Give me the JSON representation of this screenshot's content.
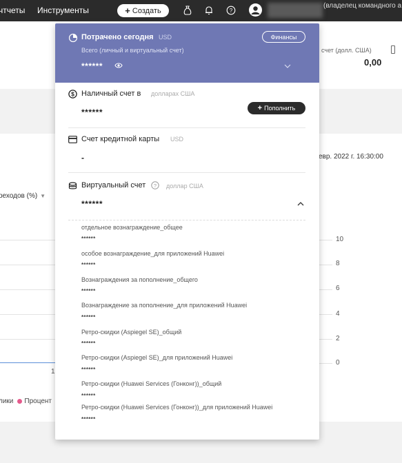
{
  "topbar": {
    "nav_reports": "чтчеты",
    "nav_tools": "Инструменты",
    "create_label": "Создать",
    "user_role": "(владелец командного а"
  },
  "background": {
    "account_label": "счет   (долл. США)",
    "account_value": "0,00",
    "date": "евр. 2022 г. 16:30:00",
    "transitions_label": "реходов (%)",
    "axis_ticks": [
      "10",
      "8",
      "6",
      "4",
      "2",
      "0"
    ],
    "x_tick": "1",
    "legend_a": "лики",
    "legend_b": "Процент"
  },
  "panel": {
    "header": {
      "title": "Потрачено сегодня",
      "currency": "USD",
      "finance_button": "Финансы",
      "subtitle": "Всего (личный и виртуальный счет)",
      "value": "******"
    },
    "cash": {
      "title": "Наличный счет в",
      "currency": "долларах США",
      "value": "******",
      "topup_label": "Пополнить"
    },
    "credit": {
      "title": "Счет кредитной карты",
      "currency": "USD",
      "value": "-"
    },
    "virtual": {
      "title": "Виртуальный счет",
      "currency": "доллар США",
      "value": "******",
      "items": [
        {
          "label": "отдельное вознаграждение_общее",
          "value": "******"
        },
        {
          "label": "особое вознаграждение_для приложений Huawei",
          "value": "******"
        },
        {
          "label": "Вознаграждения за пополнение_общего",
          "value": "******"
        },
        {
          "label": "Вознаграждение за пополнение_для приложений Huawei",
          "value": "******"
        },
        {
          "label": "Ретро-скидки (Aspiegel SE)_общий",
          "value": "******"
        },
        {
          "label": "Ретро-скидки (Aspiegel SE)_для приложений Huawei",
          "value": "******"
        },
        {
          "label": "Ретро-скидки (Huawei Services (Гонконг))_общий",
          "value": "******"
        },
        {
          "label": "Ретро-скидки (Huawei Services (Гонконг))_для приложений Huawei",
          "value": "******"
        }
      ]
    }
  },
  "colors": {
    "topbar": "#2b2b2b",
    "panel_header": "#6f78b4",
    "legend_dot": "#e55a8c"
  }
}
